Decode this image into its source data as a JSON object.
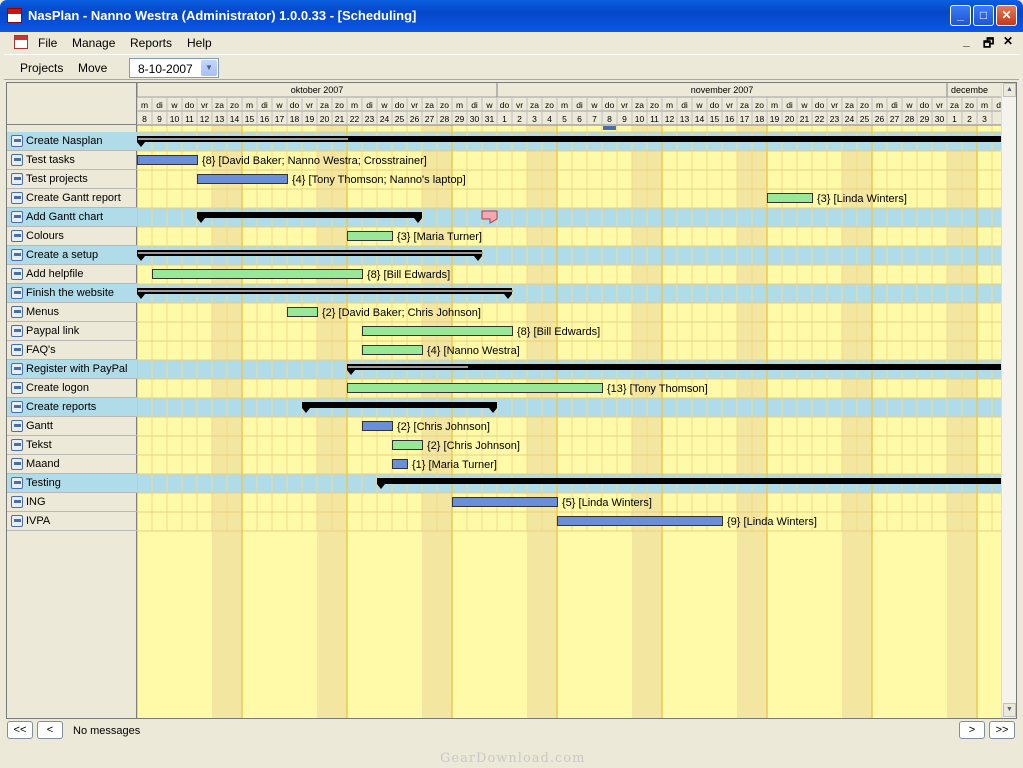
{
  "window": {
    "title": "NasPlan - Nanno Westra (Administrator) 1.0.0.33 - [Scheduling]",
    "min": "_",
    "max": "□",
    "close": "✕"
  },
  "menu": {
    "items": [
      "File",
      "Manage",
      "Reports",
      "Help"
    ],
    "mdi": [
      "_",
      "🗗",
      "✕"
    ]
  },
  "toolbar": {
    "projects": "Projects",
    "move": "Move",
    "date": "8-10-2007"
  },
  "months": [
    "oktober 2007",
    "november 2007",
    "decembe"
  ],
  "day_letters": [
    "m",
    "di",
    "w",
    "do",
    "vr",
    "za",
    "zo",
    "m",
    "di",
    "w",
    "do",
    "vr",
    "za",
    "zo",
    "m",
    "di",
    "w",
    "do",
    "vr",
    "za",
    "zo",
    "m",
    "di",
    "w",
    "do",
    "vr",
    "za",
    "zo",
    "m",
    "di",
    "w",
    "do",
    "vr",
    "za",
    "zo",
    "m",
    "di",
    "w",
    "do",
    "vr",
    "za",
    "zo",
    "m",
    "di",
    "w",
    "do",
    "vr",
    "za",
    "zo",
    "m",
    "di",
    "w",
    "do",
    "vr",
    "za",
    "zo",
    "m",
    "di"
  ],
  "day_numbers": [
    "8",
    "9",
    "10",
    "11",
    "12",
    "13",
    "14",
    "15",
    "16",
    "17",
    "18",
    "19",
    "20",
    "21",
    "22",
    "23",
    "24",
    "25",
    "26",
    "27",
    "28",
    "29",
    "30",
    "31",
    "1",
    "2",
    "3",
    "4",
    "5",
    "6",
    "7",
    "8",
    "9",
    "10",
    "11",
    "12",
    "13",
    "14",
    "15",
    "16",
    "17",
    "18",
    "19",
    "20",
    "21",
    "22",
    "23",
    "24",
    "25",
    "26",
    "27",
    "28",
    "29",
    "30",
    "1",
    "2",
    "3"
  ],
  "tasks": [
    {
      "name": "Create Nasplan",
      "summary": true,
      "start": 0,
      "end": 58,
      "progress": 14,
      "label": ""
    },
    {
      "name": "Test tasks",
      "summary": false,
      "color": "#6a8fd8",
      "start": 0,
      "end": 4,
      "label": "{8} [David Baker; Nanno Westra; Crosstrainer]"
    },
    {
      "name": "Test projects",
      "summary": false,
      "color": "#6a8fd8",
      "start": 4,
      "end": 10,
      "label": "{4} [Tony Thomson; Nanno's laptop]"
    },
    {
      "name": "Create Gantt report",
      "summary": false,
      "color": "#98e898",
      "start": 42,
      "end": 45,
      "label": "{3} [Linda Winters]"
    },
    {
      "name": "Add Gantt chart",
      "summary": true,
      "start": 4,
      "end": 19,
      "progress": 4,
      "label": ""
    },
    {
      "name": "Colours",
      "summary": false,
      "color": "#98e898",
      "start": 14,
      "end": 17,
      "label": "{3} [Maria Turner]"
    },
    {
      "name": "Create a setup",
      "summary": true,
      "start": 0,
      "end": 23,
      "progress": 23,
      "label": ""
    },
    {
      "name": "Add helpfile",
      "summary": false,
      "color": "#98e898",
      "start": 1,
      "end": 15,
      "label": "{8} [Bill Edwards]"
    },
    {
      "name": "Finish the website",
      "summary": true,
      "start": 0,
      "end": 25,
      "progress": 25,
      "label": ""
    },
    {
      "name": "Menus",
      "summary": false,
      "color": "#98e898",
      "start": 10,
      "end": 12,
      "label": "{2} [David Baker; Chris Johnson]"
    },
    {
      "name": "Paypal link",
      "summary": false,
      "color": "#98e898",
      "start": 15,
      "end": 25,
      "label": "{8} [Bill Edwards]"
    },
    {
      "name": "FAQ's",
      "summary": false,
      "color": "#98e898",
      "start": 15,
      "end": 19,
      "label": "{4} [Nanno Westra]"
    },
    {
      "name": "Register with PayPal",
      "summary": true,
      "start": 14,
      "end": 58,
      "progress": 22,
      "label": ""
    },
    {
      "name": "Create logon",
      "summary": false,
      "color": "#98e898",
      "start": 14,
      "end": 31,
      "label": "{13} [Tony Thomson]"
    },
    {
      "name": "Create reports",
      "summary": true,
      "start": 11,
      "end": 24,
      "progress": 0,
      "label": ""
    },
    {
      "name": "Gantt",
      "summary": false,
      "color": "#6a8fd8",
      "start": 15,
      "end": 17,
      "label": "{2} [Chris Johnson]"
    },
    {
      "name": "Tekst",
      "summary": false,
      "color": "#98e898",
      "start": 17,
      "end": 19,
      "label": "{2} [Chris Johnson]"
    },
    {
      "name": "Maand",
      "summary": false,
      "color": "#6a8fd8",
      "start": 17,
      "end": 18,
      "label": "{1} [Maria Turner]"
    },
    {
      "name": "Testing",
      "summary": true,
      "start": 16,
      "end": 58,
      "progress": 0,
      "label": ""
    },
    {
      "name": "ING",
      "summary": false,
      "color": "#6a8fd8",
      "start": 21,
      "end": 28,
      "label": "{5} [Linda Winters]"
    },
    {
      "name": "IVPA",
      "summary": false,
      "color": "#6a8fd8",
      "start": 28,
      "end": 39,
      "label": "{9} [Linda Winters]"
    }
  ],
  "milestone": {
    "row": 4,
    "day": 23
  },
  "today_day": 31,
  "colors": {
    "weekday": "#fefaa8",
    "weekend": "#f3e6a0",
    "summary_row": "#b0dbe8",
    "grid": "#f0c850"
  },
  "status": {
    "first": "<<",
    "prev": "<",
    "message": "No messages",
    "next": ">",
    "last": ">>"
  },
  "watermark": "GearDownload.com"
}
